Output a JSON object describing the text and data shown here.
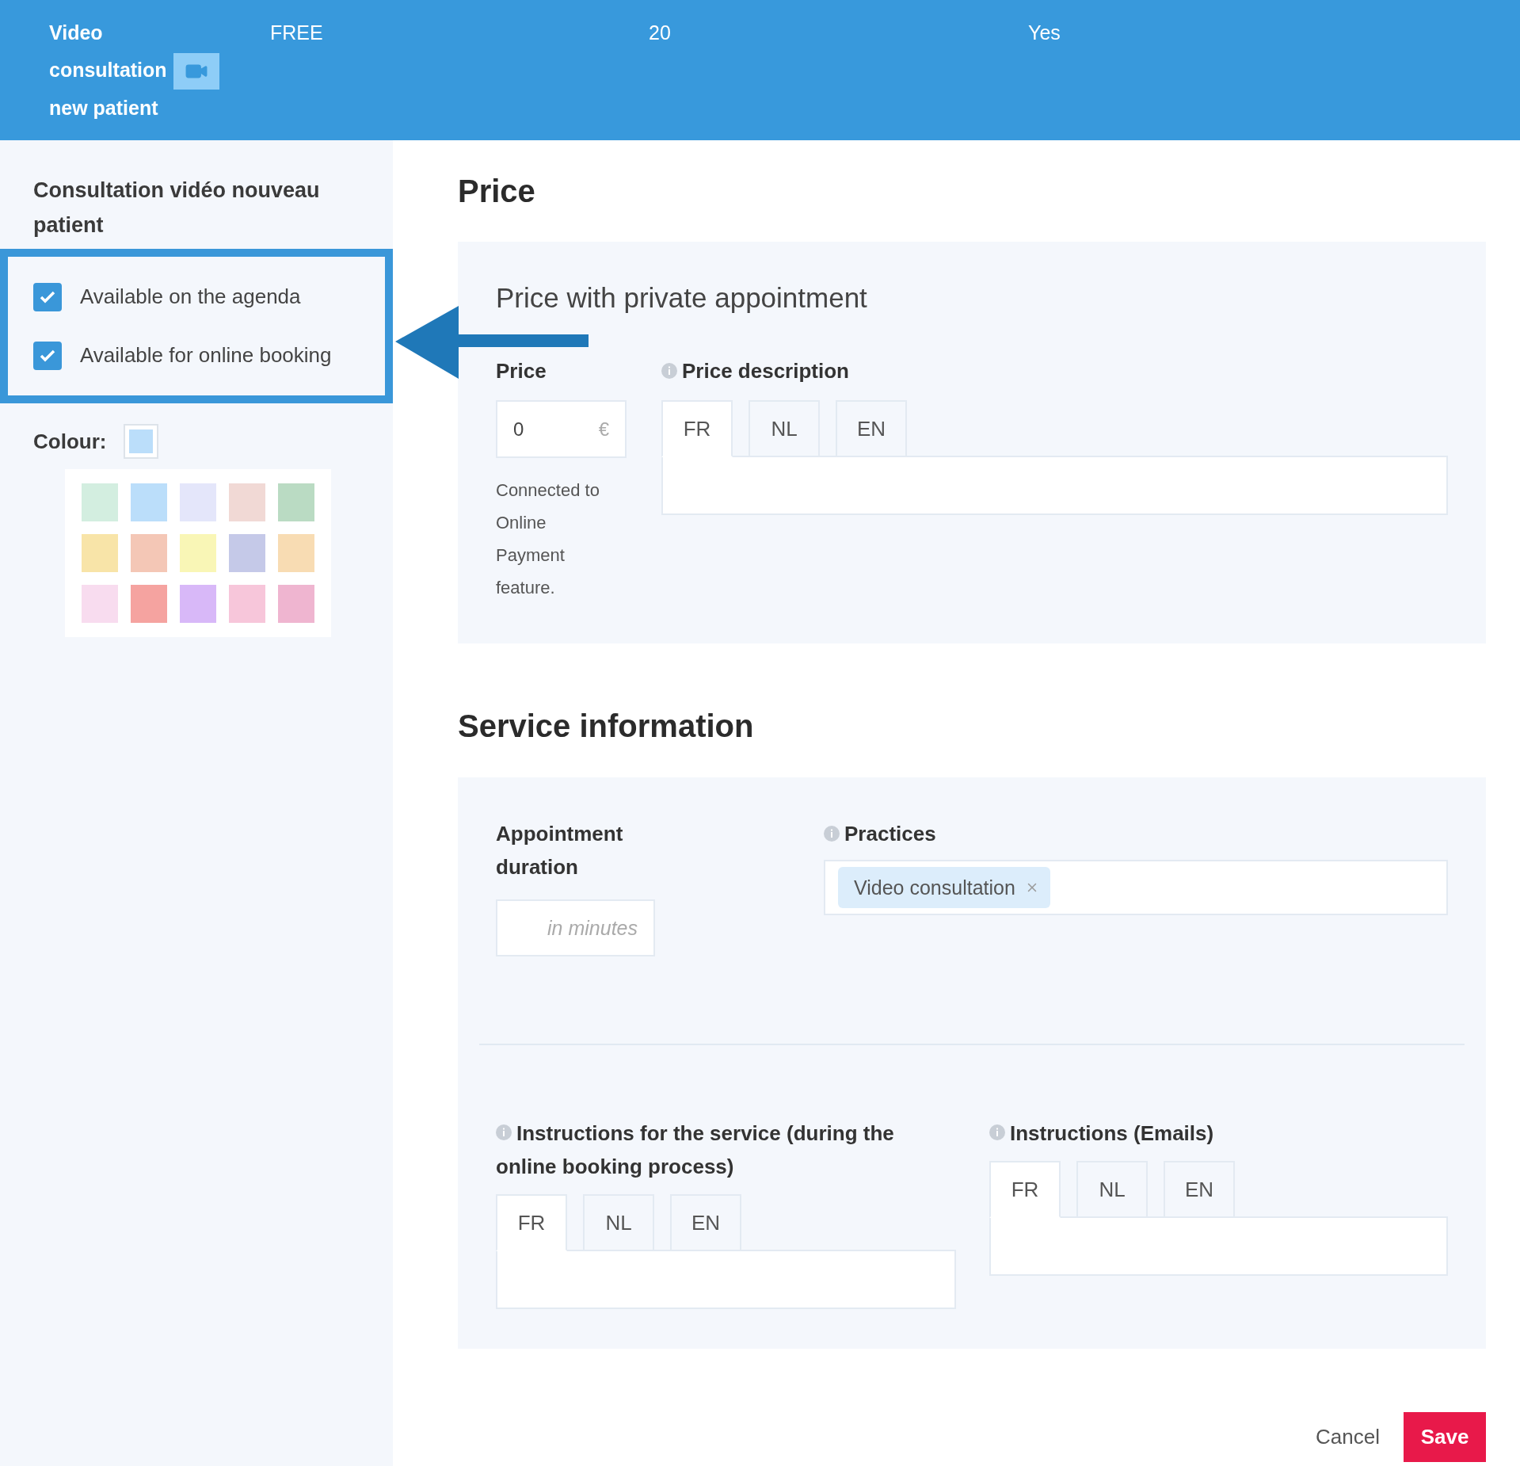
{
  "header": {
    "title": "Video consultation",
    "title_continued": "new patient",
    "columns": [
      "FREE",
      "20",
      "Yes"
    ]
  },
  "sidebar": {
    "title": "Consultation vidéo nouveau patient",
    "options": [
      {
        "label": "Available on the agenda",
        "checked": true
      },
      {
        "label": "Available for online booking",
        "checked": true
      }
    ],
    "colour": {
      "label": "Colour:",
      "color": "#bbdefa"
    },
    "palette": [
      {
        "color": "#d3eee0"
      },
      {
        "color": "#bbdefa"
      },
      {
        "color": "#e4e6fa"
      },
      {
        "color": "#f1d9d5"
      },
      {
        "color": "#badbc3"
      },
      {
        "color": "#f8e4a8"
      },
      {
        "color": "#f4c7b6"
      },
      {
        "color": "#f9f6b6"
      },
      {
        "color": "#c5c9e8"
      },
      {
        "color": "#f8dcb3"
      },
      {
        "color": "#f8dcef"
      },
      {
        "color": "#f5a3a0"
      },
      {
        "color": "#d8b8f8"
      },
      {
        "color": "#f7c6da"
      },
      {
        "color": "#efb5d0"
      }
    ]
  },
  "price": {
    "heading": "Price",
    "panel_title": "Price with private appointment",
    "price_label": "Price",
    "price_value": "0",
    "currency": "€",
    "note": "Connected to Online Payment feature.",
    "description_label": "Price description",
    "tabs": [
      {
        "label": "FR",
        "selected": true
      },
      {
        "label": "NL",
        "selected": false
      },
      {
        "label": "EN",
        "selected": false
      }
    ]
  },
  "service": {
    "heading": "Service information",
    "duration_label": "Appointment duration",
    "duration_placeholder": "in minutes",
    "practices_label": "Practices",
    "practices": [
      {
        "label": "Video consultation"
      }
    ],
    "instructions": [
      {
        "label": "Instructions for the service (during the online booking process)",
        "tabs": [
          {
            "label": "FR",
            "selected": true
          },
          {
            "label": "NL",
            "selected": false
          },
          {
            "label": "EN",
            "selected": false
          }
        ]
      },
      {
        "label": "Instructions (Emails)",
        "tabs": [
          {
            "label": "FR",
            "selected": true
          },
          {
            "label": "NL",
            "selected": false
          },
          {
            "label": "EN",
            "selected": false
          }
        ]
      }
    ]
  },
  "actions": {
    "cancel": "Cancel",
    "save": "Save"
  }
}
